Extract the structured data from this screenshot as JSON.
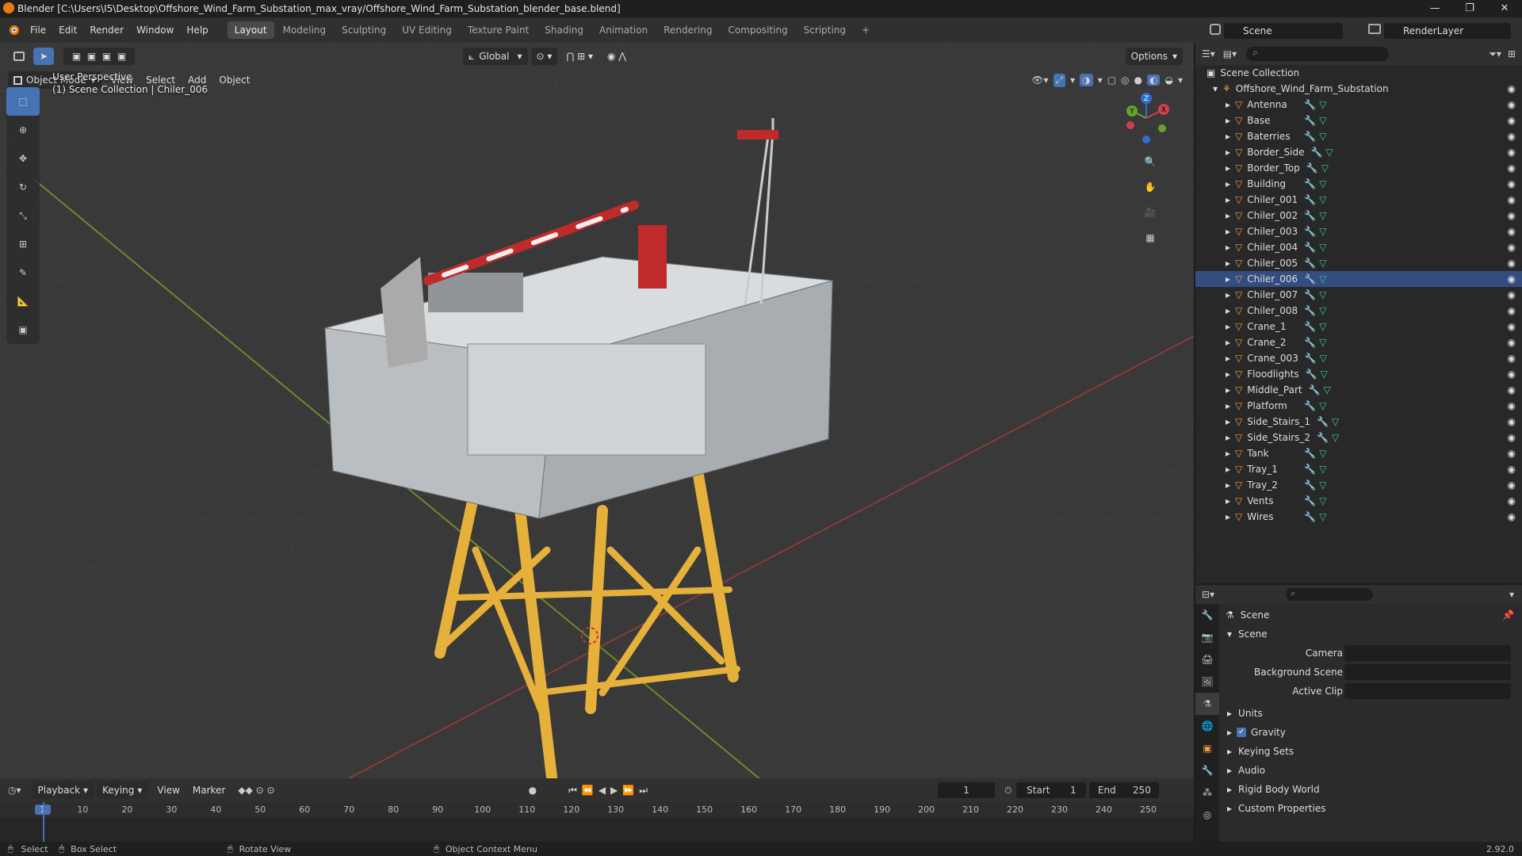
{
  "window": {
    "title": "Blender [C:\\Users\\I5\\Desktop\\Offshore_Wind_Farm_Substation_max_vray/Offshore_Wind_Farm_Substation_blender_base.blend]",
    "minimize": "—",
    "maximize": "❐",
    "close": "✕"
  },
  "menu": [
    "File",
    "Edit",
    "Render",
    "Window",
    "Help"
  ],
  "workspaces": [
    "Layout",
    "Modeling",
    "Sculpting",
    "UV Editing",
    "Texture Paint",
    "Shading",
    "Animation",
    "Rendering",
    "Compositing",
    "Scripting",
    "+"
  ],
  "active_workspace": "Layout",
  "scene_name": "Scene",
  "render_layer": "RenderLayer",
  "viewport": {
    "mode": "Object Mode",
    "menus": [
      "View",
      "Select",
      "Add",
      "Object"
    ],
    "transform_orientation": "Global",
    "options_label": "Options",
    "perspective_label": "User Perspective",
    "collection_label": "(1) Scene Collection | Chiler_006"
  },
  "gizmo": {
    "x": "X",
    "y": "Y",
    "z": "Z"
  },
  "outliner": {
    "root": "Scene Collection",
    "collection": "Offshore_Wind_Farm_Substation",
    "items": [
      "Antenna",
      "Base",
      "Baterries",
      "Border_Side",
      "Border_Top",
      "Building",
      "Chiler_001",
      "Chiler_002",
      "Chiler_003",
      "Chiler_004",
      "Chiler_005",
      "Chiler_006",
      "Chiler_007",
      "Chiler_008",
      "Crane_1",
      "Crane_2",
      "Crane_003",
      "Floodlights",
      "Middle_Part",
      "Platform",
      "Side_Stairs_1",
      "Side_Stairs_2",
      "Tank",
      "Tray_1",
      "Tray_2",
      "Vents",
      "Wires"
    ],
    "selected": "Chiler_006"
  },
  "properties": {
    "context": "Scene",
    "panel": "Scene",
    "camera_label": "Camera",
    "background_scene_label": "Background Scene",
    "active_clip_label": "Active Clip",
    "subpanels": [
      "Units",
      "Gravity",
      "Keying Sets",
      "Audio",
      "Rigid Body World",
      "Custom Properties"
    ],
    "gravity_checked": true,
    "version": "2.92.0"
  },
  "timeline": {
    "menus": [
      "Playback",
      "Keying",
      "View",
      "Marker"
    ],
    "current_frame": "1",
    "start_label": "Start",
    "start_value": "1",
    "end_label": "End",
    "end_value": "250",
    "ticks": [
      "1",
      "10",
      "20",
      "30",
      "40",
      "50",
      "60",
      "70",
      "80",
      "90",
      "100",
      "110",
      "120",
      "130",
      "140",
      "150",
      "160",
      "170",
      "180",
      "190",
      "200",
      "210",
      "220",
      "230",
      "240",
      "250"
    ]
  },
  "statusbar": {
    "select": "Select",
    "box_select": "Box Select",
    "rotate_view": "Rotate View",
    "context_menu": "Object Context Menu"
  }
}
